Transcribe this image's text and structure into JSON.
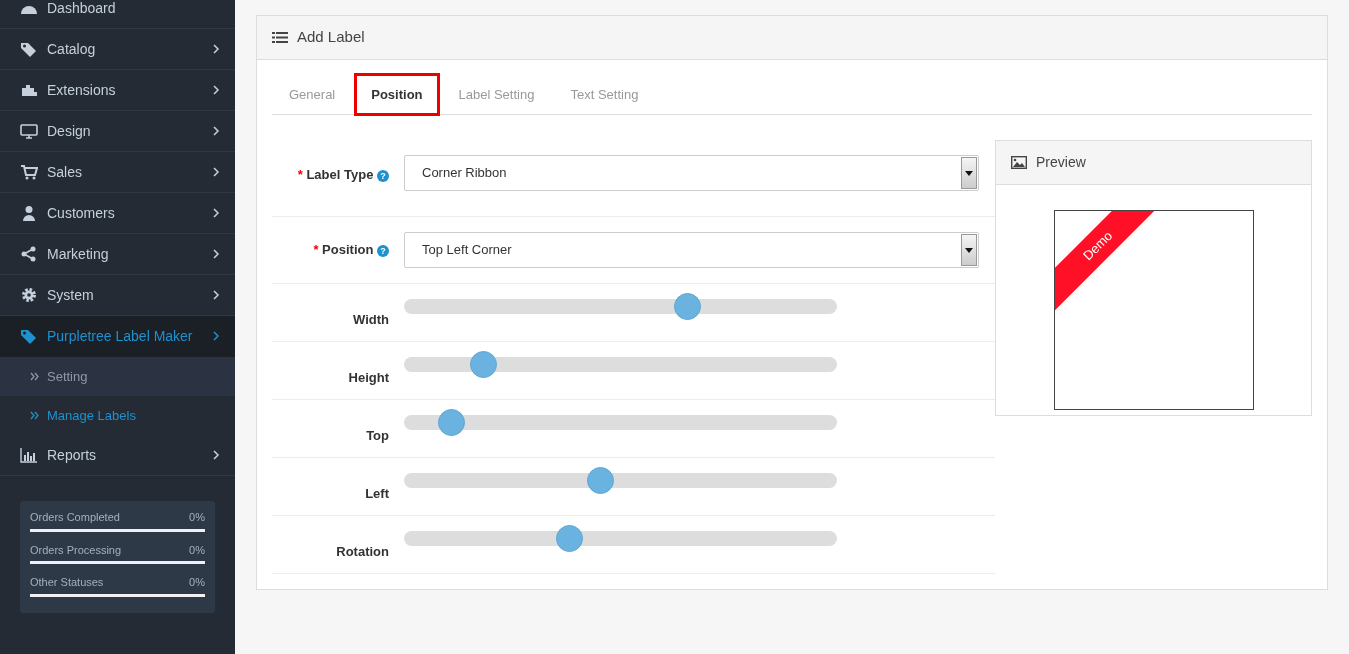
{
  "sidebar": {
    "items": [
      {
        "label": "Dashboard",
        "selected": false,
        "has_arrow": false
      },
      {
        "label": "Catalog",
        "selected": false,
        "has_arrow": true
      },
      {
        "label": "Extensions",
        "selected": false,
        "has_arrow": true
      },
      {
        "label": "Design",
        "selected": false,
        "has_arrow": true
      },
      {
        "label": "Sales",
        "selected": false,
        "has_arrow": true
      },
      {
        "label": "Customers",
        "selected": false,
        "has_arrow": true
      },
      {
        "label": "Marketing",
        "selected": false,
        "has_arrow": true
      },
      {
        "label": "System",
        "selected": false,
        "has_arrow": true
      },
      {
        "label": "Purpletree Label Maker",
        "selected": true,
        "has_arrow": true,
        "children": [
          {
            "label": "Setting",
            "selected": false
          },
          {
            "label": "Manage Labels",
            "selected": true
          }
        ]
      },
      {
        "label": "Reports",
        "selected": false,
        "has_arrow": true
      }
    ],
    "stats": [
      {
        "label": "Orders Completed",
        "reading": "0%",
        "level": 0
      },
      {
        "label": "Orders Processing",
        "reading": "0%",
        "level": 0
      },
      {
        "label": "Other Statuses",
        "reading": "0%",
        "level": 0
      }
    ]
  },
  "panel": {
    "title": "Add Label",
    "tabs": [
      {
        "label": "General",
        "selected": false,
        "highlighted": false
      },
      {
        "label": "Position",
        "selected": true,
        "highlighted": true
      },
      {
        "label": "Label Setting",
        "selected": false,
        "highlighted": false
      },
      {
        "label": "Text Setting",
        "selected": false,
        "highlighted": false
      }
    ],
    "fields": [
      {
        "kind": "select",
        "required_mark": "*",
        "label": "Label Type",
        "help": "?",
        "value": "Corner Ribbon"
      },
      {
        "kind": "select",
        "required_mark": "*",
        "label": "Position",
        "help": "?",
        "value": "Top Left Corner"
      },
      {
        "kind": "slider",
        "label": "Width",
        "level": 0.654
      },
      {
        "kind": "slider",
        "label": "Height",
        "level": 0.183
      },
      {
        "kind": "slider",
        "label": "Top",
        "level": 0.109
      },
      {
        "kind": "slider",
        "label": "Left",
        "level": 0.453
      },
      {
        "kind": "slider",
        "label": "Rotation",
        "level": 0.381
      }
    ],
    "preview": {
      "title": "Preview",
      "ribbon_text": "Demo"
    }
  }
}
